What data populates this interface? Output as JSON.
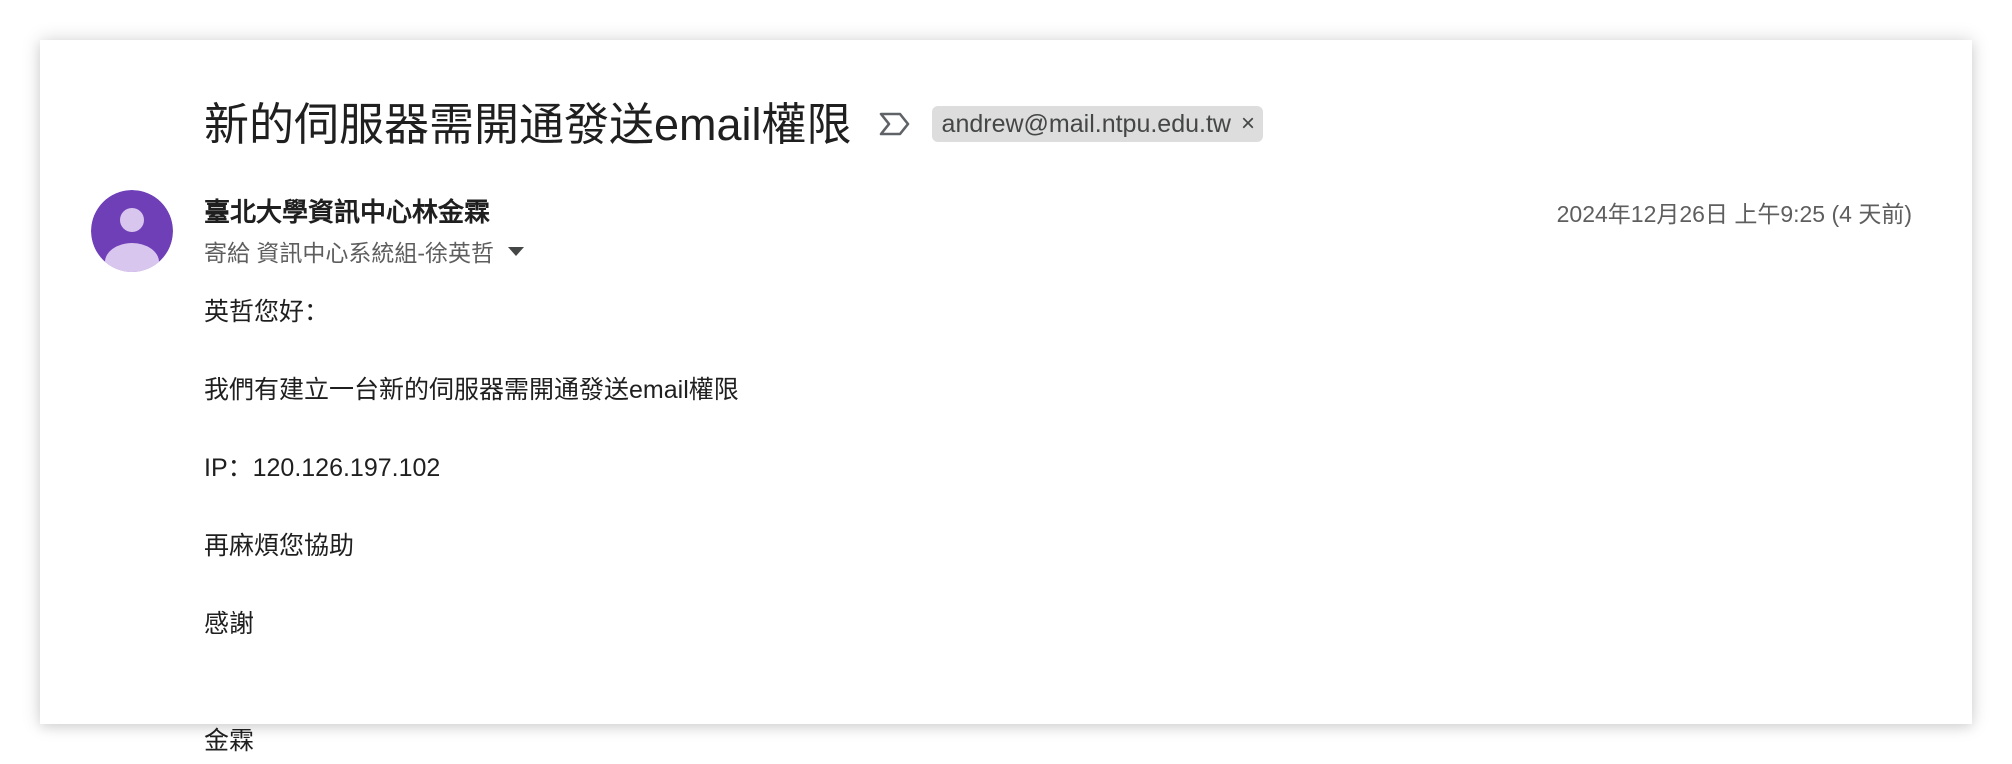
{
  "email": {
    "subject": "新的伺服器需開通發送email權限",
    "label": "andrew@mail.ntpu.edu.tw",
    "label_remove": "×",
    "sender": "臺北大學資訊中心林金霖",
    "recipient": "寄給 資訊中心系統組-徐英哲",
    "date": "2024年12月26日 上午9:25 (4 天前)",
    "body": {
      "greeting": "英哲您好：",
      "line1": "我們有建立一台新的伺服器需開通發送email權限",
      "ip": "IP：120.126.197.102",
      "line2": "再麻煩您協助",
      "thanks": "感謝",
      "signature": "金霖"
    }
  },
  "colors": {
    "avatar_bg": "#6f3fb8",
    "avatar_figure": "#d9c6ee",
    "label_chip_bg": "#dddddd"
  },
  "icons": {
    "important": "important-marker-icon",
    "avatar": "default-avatar-icon",
    "expand": "caret-down-icon"
  }
}
